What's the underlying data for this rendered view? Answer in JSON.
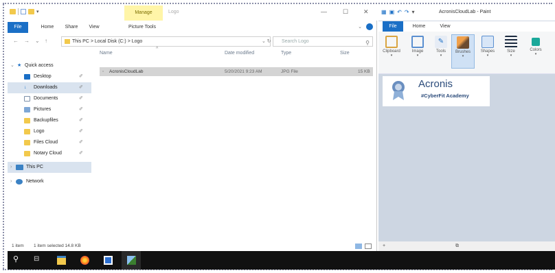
{
  "explorer": {
    "title": "Logo",
    "manage_tab": "Manage",
    "ribbon_tabs": [
      "File",
      "Home",
      "Share",
      "View",
      "Picture Tools"
    ],
    "address": {
      "parts": "This PC  >  Local Disk (C:)  >  Logo"
    },
    "search": {
      "placeholder": "Search Logo"
    },
    "window_controls": {
      "minimize": "—",
      "maximize": "☐",
      "close": "✕"
    },
    "nav": {
      "quick_access": "Quick access",
      "items": [
        {
          "label": "Desktop",
          "icon": "desktop-icon",
          "pinned": true
        },
        {
          "label": "Downloads",
          "icon": "downloads-icon",
          "pinned": true
        },
        {
          "label": "Documents",
          "icon": "documents-icon",
          "pinned": true
        },
        {
          "label": "Pictures",
          "icon": "pictures-icon",
          "pinned": true
        },
        {
          "label": "Backupfiles",
          "icon": "folder-icon",
          "pinned": true
        },
        {
          "label": "Logo",
          "icon": "folder-icon",
          "pinned": true
        },
        {
          "label": "Files Cloud",
          "icon": "folder-icon",
          "pinned": true
        },
        {
          "label": "Notary Cloud",
          "icon": "folder-icon",
          "pinned": true
        }
      ],
      "this_pc": "This PC",
      "network": "Network"
    },
    "columns": [
      "Name",
      "Date modified",
      "Type",
      "Size"
    ],
    "files": [
      {
        "name": "AcronisCloudLab",
        "date": "5/20/2021 9:23 AM",
        "type": "JPG File",
        "size": "15 KB"
      }
    ],
    "status": {
      "items": "1 item",
      "selected": "1 item selected  14.8 KB"
    }
  },
  "paint": {
    "title": "AcronisCloudLab - Paint",
    "tabs": [
      "File",
      "Home",
      "View"
    ],
    "groups": [
      "Clipboard",
      "Image",
      "Tools",
      "Brushes",
      "Shapes",
      "Size",
      "Colors"
    ],
    "active_group": "Brushes",
    "image": {
      "brand": "Acronis",
      "tagline": "#CyberFit Academy"
    }
  },
  "taskbar": {
    "items": [
      "start-button",
      "search-icon",
      "task-view-icon",
      "file-explorer-icon",
      "firefox-icon",
      "app-icon",
      "paint-icon"
    ]
  },
  "colors": {
    "accent": "#1a6fc6",
    "manage_tab": "#fff5a8",
    "taskbar": "#111111",
    "canvas_bg": "#cdd6e2"
  }
}
